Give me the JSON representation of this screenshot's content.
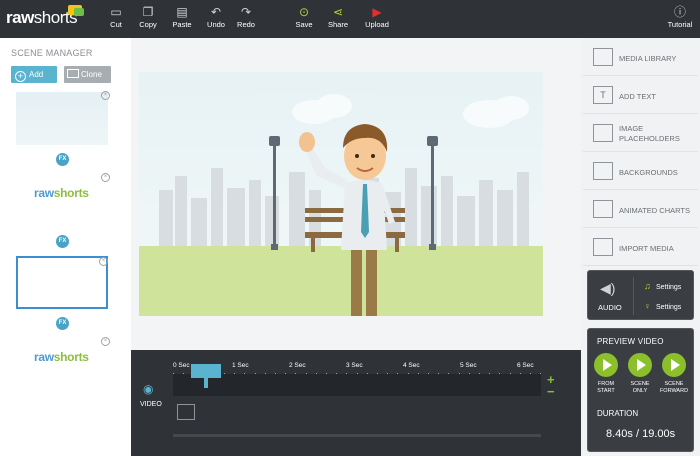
{
  "app": {
    "brand_main": "raw",
    "brand_accent": "shorts"
  },
  "toolbar": {
    "cut": "Cut",
    "copy": "Copy",
    "paste": "Paste",
    "undo": "Undo",
    "redo": "Redo",
    "save": "Save",
    "share": "Share",
    "upload": "Upload",
    "tutorial": "Tutorial"
  },
  "scene_manager": {
    "title": "SCENE MANAGER",
    "add_label": "Add",
    "clone_label": "Clone",
    "fx_label": "FX",
    "thumb_logo_main": "raw",
    "thumb_logo_accent": "shorts"
  },
  "right_panel": {
    "items": [
      {
        "label": "MEDIA LIBRARY"
      },
      {
        "label": "ADD TEXT"
      },
      {
        "label": "IMAGE PLACEHOLDERS"
      },
      {
        "label": "BACKGROUNDS"
      },
      {
        "label": "ANIMATED CHARTS"
      },
      {
        "label": "IMPORT MEDIA"
      }
    ],
    "audio": {
      "label": "AUDIO",
      "settings_1": "Settings",
      "settings_2": "Settings"
    },
    "preview": {
      "title": "PREVIEW VIDEO",
      "from_start": "FROM START",
      "scene_only": "SCENE ONLY",
      "scene_forward": "SCENE FORWARD"
    },
    "duration": {
      "title": "DURATION",
      "value": "8.40s / 19.00s"
    }
  },
  "timeline": {
    "ticks": [
      "0 Sec",
      "1 Sec",
      "2 Sec",
      "3 Sec",
      "4 Sec",
      "5 Sec",
      "6 Sec"
    ],
    "video_label": "VIDEO",
    "zoom_in": "+",
    "zoom_out": "−"
  },
  "colors": {
    "topbar": "#2f3338",
    "accent_blue": "#5ab4cf",
    "accent_green": "#8cbf2c",
    "upload_red": "#e0302e"
  }
}
